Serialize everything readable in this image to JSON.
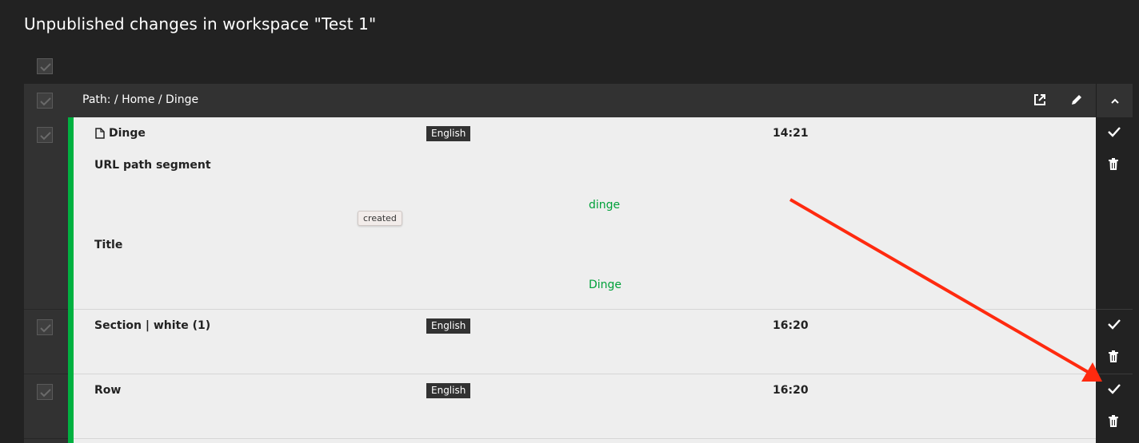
{
  "page": {
    "title": "Unpublished changes in workspace \"Test 1\""
  },
  "group": {
    "path": "Path: / Home / Dinge",
    "actions": [
      "external-link-icon",
      "pencil-icon",
      "chevron-up-icon"
    ]
  },
  "rows": [
    {
      "name": "Dinge",
      "icon": "document-icon",
      "language": "English",
      "time": "14:21",
      "properties": [
        {
          "label": "URL path segment",
          "value": "dinge"
        },
        {
          "label": "Title",
          "value": "Dinge"
        }
      ],
      "badge": "created"
    },
    {
      "name": "Section | white (1)",
      "language": "English",
      "time": "16:20"
    },
    {
      "name": "Row",
      "language": "English",
      "time": "16:20"
    }
  ],
  "colors": {
    "background": "#222222",
    "panel": "#323232",
    "content": "#eeeeee",
    "status_created": "#00b140",
    "annotation_arrow": "#ff2a0f"
  }
}
